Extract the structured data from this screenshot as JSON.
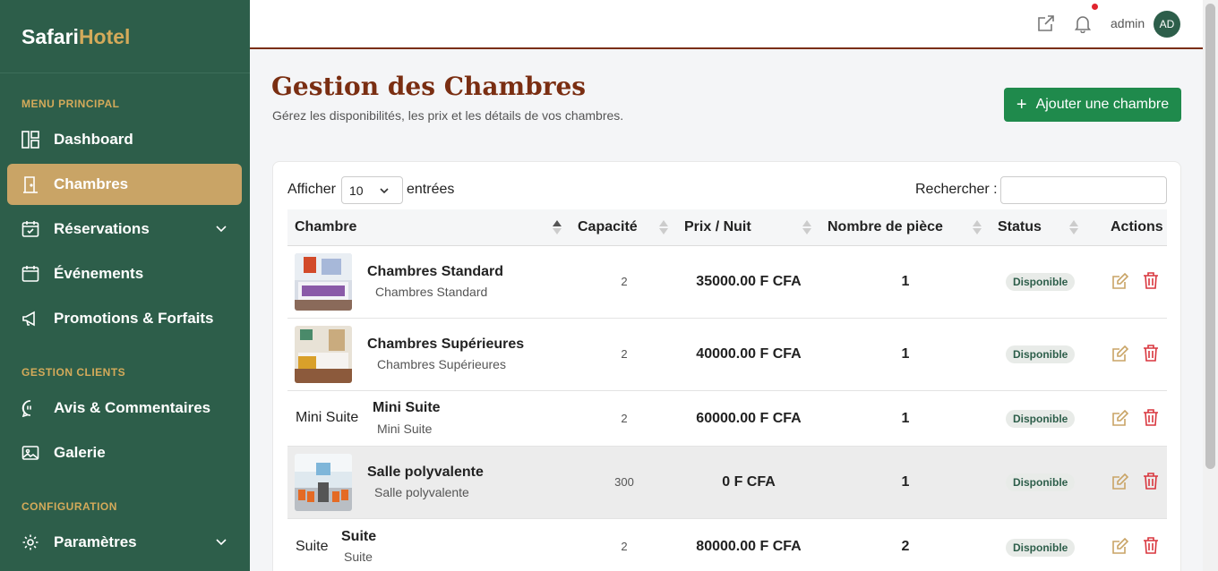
{
  "brand": {
    "part1": "Safari",
    "part2": "Hotel"
  },
  "sidebar": {
    "sections": [
      "MENU PRINCIPAL",
      "GESTION CLIENTS",
      "CONFIGURATION"
    ],
    "items": [
      {
        "label": "Dashboard",
        "icon": "dashboard-icon"
      },
      {
        "label": "Chambres",
        "icon": "door-icon",
        "active": true
      },
      {
        "label": "Réservations",
        "icon": "calendar-check-icon",
        "has_submenu": true
      },
      {
        "label": "Événements",
        "icon": "calendar-icon"
      },
      {
        "label": "Promotions & Forfaits",
        "icon": "megaphone-icon"
      },
      {
        "label": "Avis & Commentaires",
        "icon": "chat-quote-icon"
      },
      {
        "label": "Galerie",
        "icon": "image-icon"
      },
      {
        "label": "Paramètres",
        "icon": "gear-icon",
        "has_submenu": true
      }
    ]
  },
  "topbar": {
    "user": "admin",
    "avatar_initials": "AD",
    "has_notification": true
  },
  "page": {
    "title": "Gestion des Chambres",
    "subtitle": "Gérez les disponibilités, les prix et les détails de vos chambres.",
    "add_button": "Ajouter une chambre"
  },
  "table_controls": {
    "show_label": "Afficher",
    "page_length": "10",
    "entries_label": "entrées",
    "search_label": "Rechercher :"
  },
  "table": {
    "columns": [
      "Chambre",
      "Capacité",
      "Prix / Nuit",
      "Nombre de pièce",
      "Status",
      "Actions"
    ],
    "rows": [
      {
        "name": "Chambres Standard",
        "sub": "Chambres Standard",
        "image": "room-photo",
        "capacity": "2",
        "price": "35000.00 F CFA",
        "pieces": "1",
        "status": "Disponible"
      },
      {
        "name": "Chambres Supérieures",
        "sub": "Chambres Supérieures",
        "image": "room-photo",
        "capacity": "2",
        "price": "40000.00 F CFA",
        "pieces": "1",
        "status": "Disponible"
      },
      {
        "name": "Mini Suite",
        "sub": "Mini Suite",
        "image_alt": "Mini Suite",
        "capacity": "2",
        "price": "60000.00 F CFA",
        "pieces": "1",
        "status": "Disponible"
      },
      {
        "name": "Salle polyvalente",
        "sub": "Salle polyvalente",
        "image": "hall-photo",
        "capacity": "300",
        "price": "0 F CFA",
        "pieces": "1",
        "status": "Disponible"
      },
      {
        "name": "Suite",
        "sub": "Suite",
        "image_alt": "Suite",
        "capacity": "2",
        "price": "80000.00 F CFA",
        "pieces": "2",
        "status": "Disponible"
      }
    ]
  },
  "colors": {
    "sidebar": "#2d5e4a",
    "accent": "#c9a466",
    "title": "#7a2e12",
    "primary_button": "#1f8a4c",
    "delete": "#d9363e",
    "edit": "#c9a466"
  }
}
